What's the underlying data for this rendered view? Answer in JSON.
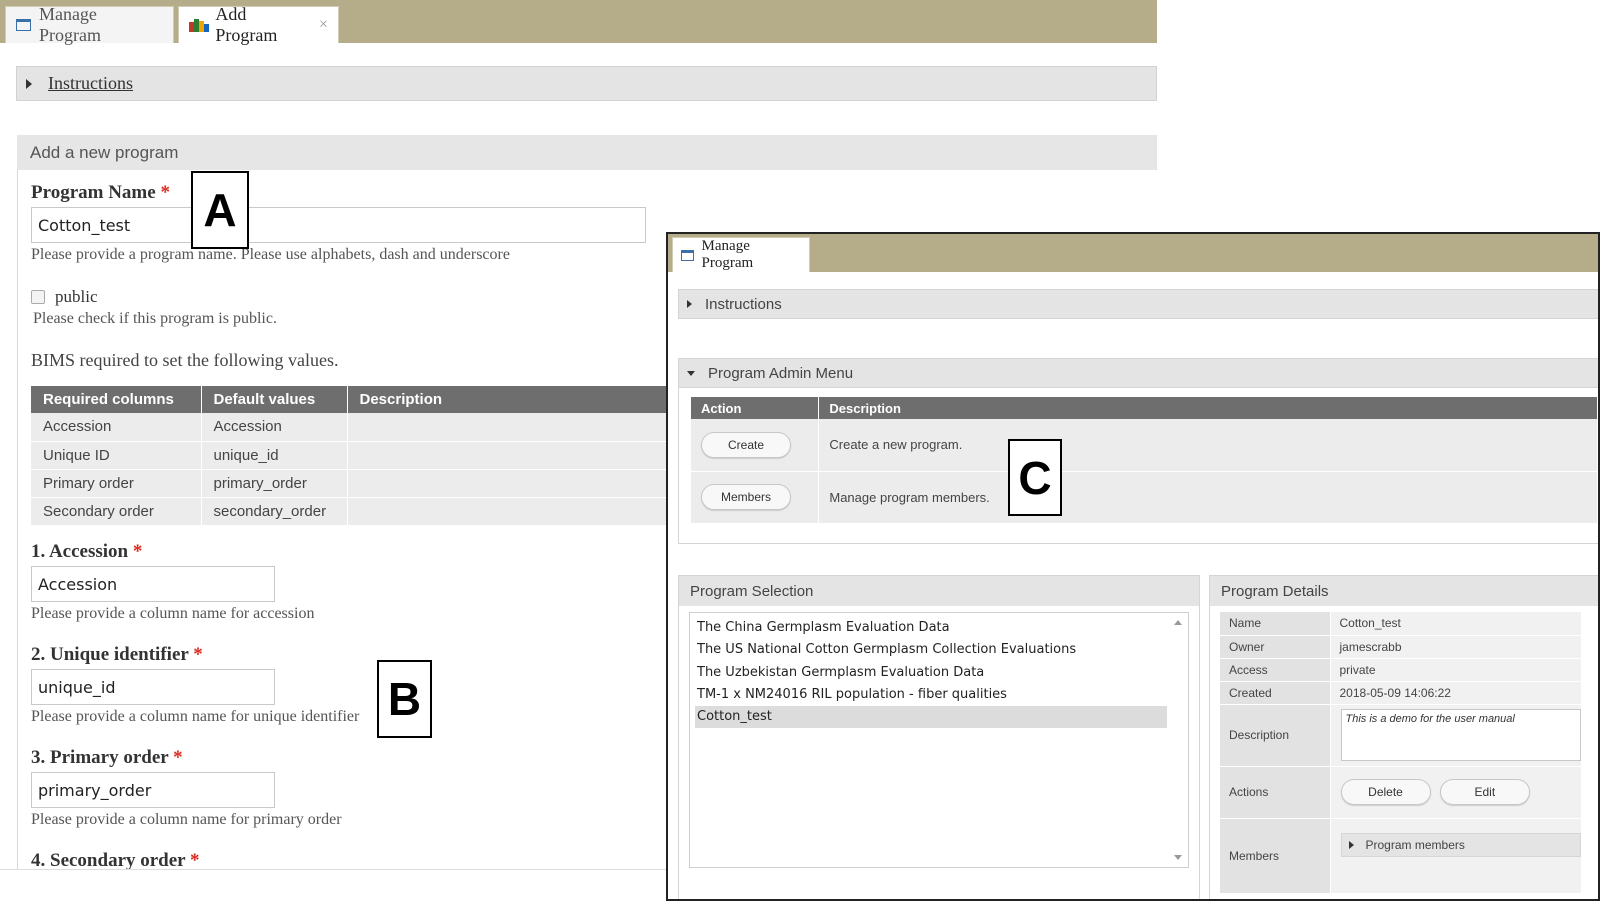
{
  "left": {
    "tabs": [
      {
        "label": "Manage Program",
        "icon": "window-icon"
      },
      {
        "label": "Add Program",
        "icon": "books-icon",
        "close": "×"
      }
    ],
    "instructions_label": "Instructions",
    "section_title": "Add a new program",
    "program_name": {
      "label": "Program Name",
      "required_mark": "*",
      "value": "Cotton_test",
      "hint": "Please provide a program name. Please use alphabets, dash and underscore"
    },
    "public": {
      "label": "public",
      "checked": false,
      "hint": "Please check if this program is public."
    },
    "bims_note": "BIMS required to set the following values.",
    "required_table": {
      "headers": [
        "Required columns",
        "Default values",
        "Description"
      ],
      "rows": [
        [
          "Accession",
          "Accession",
          ""
        ],
        [
          "Unique ID",
          "unique_id",
          ""
        ],
        [
          "Primary order",
          "primary_order",
          ""
        ],
        [
          "Secondary order",
          "secondary_order",
          ""
        ]
      ]
    },
    "fields": [
      {
        "label": "1. Accession",
        "value": "Accession",
        "hint": "Please provide a column name for accession"
      },
      {
        "label": "2. Unique identifier",
        "value": "unique_id",
        "hint": "Please provide a column name for unique identifier"
      },
      {
        "label": "3. Primary order",
        "value": "primary_order",
        "hint": "Please provide a column name for primary order"
      },
      {
        "label": "4. Secondary order",
        "value": "",
        "hint": ""
      }
    ],
    "callouts": [
      "A",
      "B"
    ]
  },
  "right": {
    "tab_label": "Manage Program",
    "instructions_label": "Instructions",
    "admin_menu": {
      "title": "Program Admin Menu",
      "headers": [
        "Action",
        "Description"
      ],
      "rows": [
        {
          "button": "Create",
          "description": "Create a new program."
        },
        {
          "button": "Members",
          "description": "Manage program members."
        }
      ]
    },
    "callout": "C",
    "program_selection": {
      "title": "Program Selection",
      "items": [
        "The China Germplasm Evaluation Data",
        "The US National Cotton Germplasm Collection Evaluations",
        "The Uzbekistan Germplasm Evaluation Data",
        "TM-1 x NM24016 RIL population - fiber qualities",
        "Cotton_test"
      ],
      "selected_index": 4
    },
    "program_details": {
      "title": "Program Details",
      "rows": [
        {
          "key": "Name",
          "value": "Cotton_test"
        },
        {
          "key": "Owner",
          "value": "jamescrabb"
        },
        {
          "key": "Access",
          "value": "private"
        },
        {
          "key": "Created",
          "value": "2018-05-09 14:06:22"
        }
      ],
      "description_key": "Description",
      "description_value": "This is a demo for the user manual",
      "actions_key": "Actions",
      "delete_button": "Delete",
      "edit_button": "Edit",
      "members_key": "Members",
      "members_toggle": "Program members"
    }
  },
  "colors": {
    "tabbar": "#b5ad8a",
    "table_header": "#6e6e6e",
    "required": "#d9281c",
    "window_icon": "#3a6fa8"
  }
}
